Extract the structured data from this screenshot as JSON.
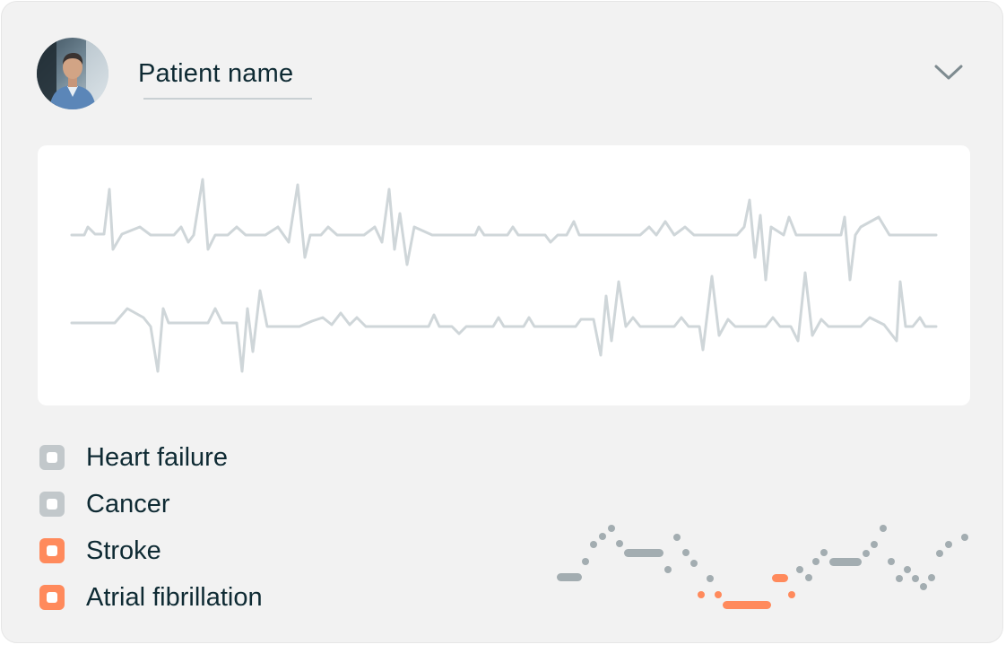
{
  "patient": {
    "name_label": "Patient name",
    "avatar_icon": "person-avatar"
  },
  "dropdown": {
    "icon": "chevron-down-icon"
  },
  "colors": {
    "ecg_line": "#cfd6d9",
    "neutral_marker": "#c2c8cb",
    "alert_marker": "#ff8a5c",
    "timeline_gray": "#a3adb1",
    "text": "#0e2a33"
  },
  "conditions": [
    {
      "label": "Heart failure",
      "status": "neutral"
    },
    {
      "label": "Cancer",
      "status": "neutral"
    },
    {
      "label": "Stroke",
      "status": "alert"
    },
    {
      "label": "Atrial fibrillation",
      "status": "alert"
    }
  ]
}
